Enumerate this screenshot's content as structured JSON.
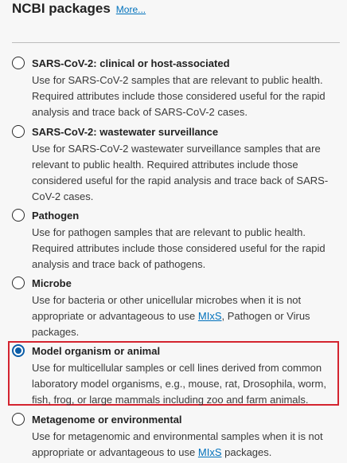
{
  "header": {
    "title": "NCBI packages",
    "more_link": "More..."
  },
  "options": [
    {
      "title": "SARS-CoV-2: clinical or host-associated",
      "desc": "Use for SARS-CoV-2 samples that are relevant to public health. Required attributes include those considered useful for the rapid analysis and trace back of SARS-CoV-2 cases.",
      "selected": false
    },
    {
      "title": "SARS-CoV-2: wastewater surveillance",
      "desc": "Use for SARS-CoV-2 wastewater surveillance samples that are relevant to public health. Required attributes include those considered useful for the rapid analysis and trace back of SARS-CoV-2 cases.",
      "selected": false
    },
    {
      "title": "Pathogen",
      "desc": "Use for pathogen samples that are relevant to public health. Required attributes include those considered useful for the rapid analysis and trace back of pathogens.",
      "selected": false
    },
    {
      "title": "Microbe",
      "desc_before": "Use for bacteria or other unicellular microbes when it is not appropriate or advantageous to use ",
      "desc_link": "MIxS",
      "desc_after": ", Pathogen or Virus packages.",
      "selected": false
    },
    {
      "title": "Model organism or animal",
      "desc": "Use for multicellular samples or cell lines derived from common laboratory model organisms, e.g., mouse, rat, Drosophila, worm, fish, frog, or large mammals including zoo and farm animals.",
      "selected": true
    },
    {
      "title": "Metagenome or environmental",
      "desc_before": "Use for metagenomic and environmental samples when it is not appropriate or advantageous to use ",
      "desc_link": "MIxS",
      "desc_after": " packages.",
      "selected": false
    }
  ],
  "colors": {
    "accent": "#0b5da7",
    "link": "#0071bc",
    "highlight_border": "#d4242f"
  }
}
